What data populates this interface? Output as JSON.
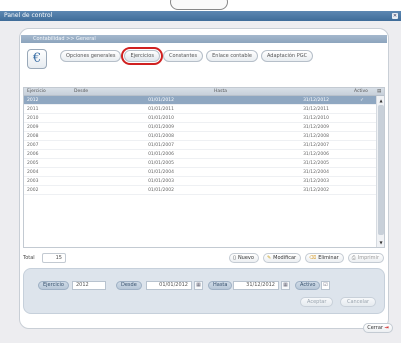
{
  "window": {
    "title": "Panel de control"
  },
  "breadcrumb": "Contabilidad >> General",
  "euro_symbol": "€",
  "tabs": [
    {
      "label": "Opciones generales",
      "selected": false
    },
    {
      "label": "Ejercicios",
      "selected": true
    },
    {
      "label": "Constantes",
      "selected": false
    },
    {
      "label": "Enlace contable",
      "selected": false
    },
    {
      "label": "Adaptación PGC",
      "selected": false
    }
  ],
  "table": {
    "columns": [
      "Ejercicio",
      "Desde",
      "Hasta",
      "Activo"
    ],
    "rows": [
      {
        "ejercicio": "2012",
        "desde": "01/01/2012",
        "hasta": "31/12/2012",
        "activo": "✓",
        "selected": true
      },
      {
        "ejercicio": "2011",
        "desde": "01/01/2011",
        "hasta": "31/12/2011",
        "activo": "",
        "selected": false
      },
      {
        "ejercicio": "2010",
        "desde": "01/01/2010",
        "hasta": "31/12/2010",
        "activo": "",
        "selected": false
      },
      {
        "ejercicio": "2009",
        "desde": "01/01/2009",
        "hasta": "31/12/2009",
        "activo": "",
        "selected": false
      },
      {
        "ejercicio": "2008",
        "desde": "01/01/2008",
        "hasta": "31/12/2008",
        "activo": "",
        "selected": false
      },
      {
        "ejercicio": "2007",
        "desde": "01/01/2007",
        "hasta": "31/12/2007",
        "activo": "",
        "selected": false
      },
      {
        "ejercicio": "2006",
        "desde": "01/01/2006",
        "hasta": "31/12/2006",
        "activo": "",
        "selected": false
      },
      {
        "ejercicio": "2005",
        "desde": "01/01/2005",
        "hasta": "31/12/2005",
        "activo": "",
        "selected": false
      },
      {
        "ejercicio": "2004",
        "desde": "01/01/2004",
        "hasta": "31/12/2004",
        "activo": "",
        "selected": false
      },
      {
        "ejercicio": "2003",
        "desde": "01/01/2003",
        "hasta": "31/12/2003",
        "activo": "",
        "selected": false
      },
      {
        "ejercicio": "2002",
        "desde": "01/01/2002",
        "hasta": "31/12/2002",
        "activo": "",
        "selected": false
      }
    ]
  },
  "total": {
    "label": "Total",
    "value": "15"
  },
  "actions": {
    "nuevo": "Nuevo",
    "modificar": "Modificar",
    "eliminar": "Eliminar",
    "imprimir": "Imprimir"
  },
  "form": {
    "ejercicio_label": "Ejercicio",
    "ejercicio_value": "2012",
    "desde_label": "Desde",
    "desde_value": "01/01/2012",
    "hasta_label": "Hasta",
    "hasta_value": "31/12/2012",
    "activo_label": "Activo",
    "aceptar": "Aceptar",
    "cancelar": "Cancelar"
  },
  "footer": {
    "close_label": "Cerrar"
  },
  "colors": {
    "titlebar": "#4a78a6",
    "selected_row": "#8fa7c1",
    "tab_highlight": "#d02020"
  }
}
